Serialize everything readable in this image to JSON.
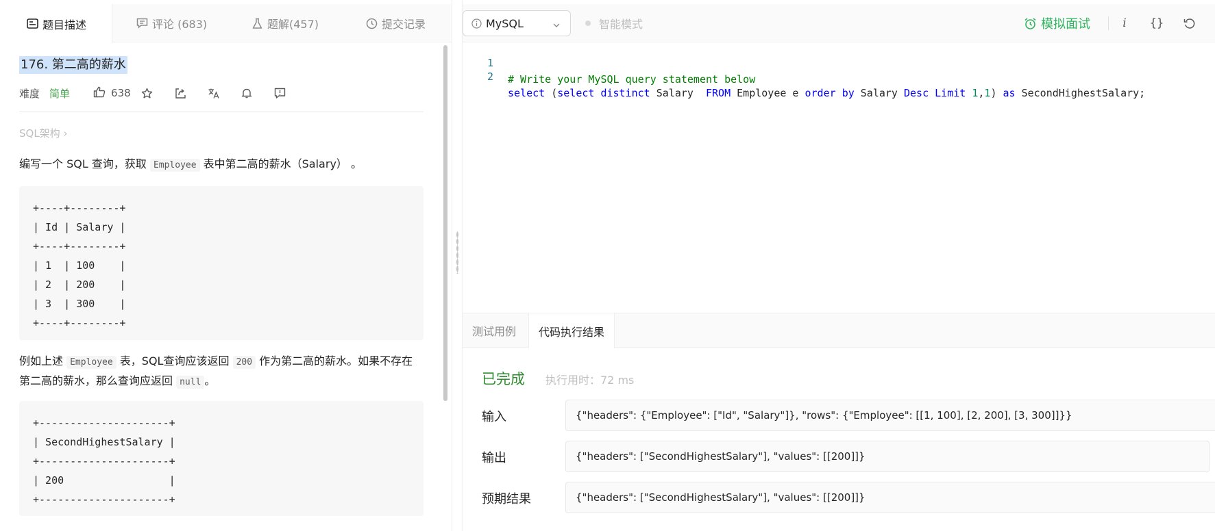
{
  "left_tabs": {
    "description": "题目描述",
    "comments": "评论 (683)",
    "solutions": "题解(457)",
    "submissions": "提交记录"
  },
  "problem": {
    "title": "176. 第二高的薪水",
    "difficulty_label": "难度",
    "difficulty": "简单",
    "likes": "638",
    "schema_link": "SQL架构 ›",
    "para1_pre": "编写一个 SQL 查询，获取 ",
    "para1_code": "Employee",
    "para1_post": " 表中第二高的薪水（Salary） 。",
    "table1": "+----+--------+\n| Id | Salary |\n+----+--------+\n| 1  | 100    |\n| 2  | 200    |\n| 3  | 300    |\n+----+--------+",
    "para2_a": "例如上述 ",
    "para2_code1": "Employee",
    "para2_b": " 表，SQL查询应该返回 ",
    "para2_code2": "200",
    "para2_c": " 作为第二高的薪水。如果不存在第二高的薪水，那么查询应返回 ",
    "para2_code3": "null",
    "para2_d": "。",
    "table2": "+---------------------+\n| SecondHighestSalary |\n+---------------------+\n| 200                 |\n+---------------------+"
  },
  "toolbar": {
    "language": "MySQL",
    "smart_mode": "智能模式",
    "mock_interview": "模拟面试",
    "info": "i",
    "format": "{}"
  },
  "editor": {
    "line1_no": "1",
    "line2_no": "2",
    "line1_comment": "# Write your MySQL query statement below",
    "l2": {
      "t1": "select",
      "t2": " (",
      "t3": "select",
      "t4": " ",
      "t5": "distinct",
      "t6": " Salary  ",
      "t7": "FROM",
      "t8": " Employee e ",
      "t9": "order",
      "t10": " ",
      "t11": "by",
      "t12": " Salary ",
      "t13": "Desc",
      "t14": " ",
      "t15": "Limit",
      "t16": " ",
      "t17": "1",
      "t18": ",",
      "t19": "1",
      "t20": ") ",
      "t21": "as",
      "t22": " SecondHighestSalary;"
    }
  },
  "result": {
    "tab_cases": "测试用例",
    "tab_result": "代码执行结果",
    "status": "已完成",
    "runtime": "执行用时：72 ms",
    "input_label": "输入",
    "input_value": "{\"headers\": {\"Employee\": [\"Id\", \"Salary\"]}, \"rows\": {\"Employee\": [[1, 100], [2, 200], [3, 300]]}}",
    "output_label": "输出",
    "output_value": "{\"headers\": [\"SecondHighestSalary\"], \"values\": [[200]]}",
    "expected_label": "预期结果",
    "expected_value": "{\"headers\": [\"SecondHighestSalary\"], \"values\": [[200]]}"
  },
  "colors": {
    "accent_green": "#2db55d",
    "keyword_blue": "#0000ff",
    "comment_green": "#008000",
    "number_green": "#09885a"
  }
}
